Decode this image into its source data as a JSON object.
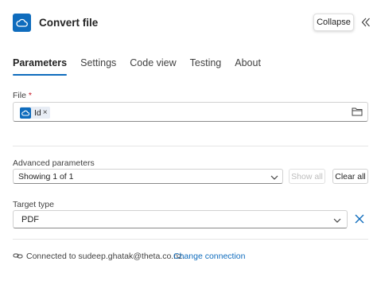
{
  "header": {
    "title": "Convert file",
    "icon": "onedrive-cloud-icon",
    "collapse_label": "Collapse",
    "collapse_panel_icon": "double-chevron-left-icon"
  },
  "tabs": [
    {
      "label": "Parameters",
      "active": true
    },
    {
      "label": "Settings",
      "active": false
    },
    {
      "label": "Code view",
      "active": false
    },
    {
      "label": "Testing",
      "active": false
    },
    {
      "label": "About",
      "active": false
    }
  ],
  "file": {
    "label": "File",
    "required_mark": "*",
    "token_label": "Id",
    "token_remove": "×",
    "token_icon": "onedrive-cloud-icon",
    "browse_icon": "folder-icon"
  },
  "advanced": {
    "label": "Advanced parameters",
    "selected": "Showing 1 of 1",
    "show_all_label": "Show all",
    "clear_all_label": "Clear all"
  },
  "target_type": {
    "label": "Target type",
    "selected": "PDF"
  },
  "connection": {
    "text": "Connected to sudeep.ghatak@theta.co.nz.",
    "change_label": "Change connection",
    "icon": "connection-link-icon"
  },
  "colors": {
    "accent": "#0f6cbd",
    "required": "#c50f1f"
  }
}
